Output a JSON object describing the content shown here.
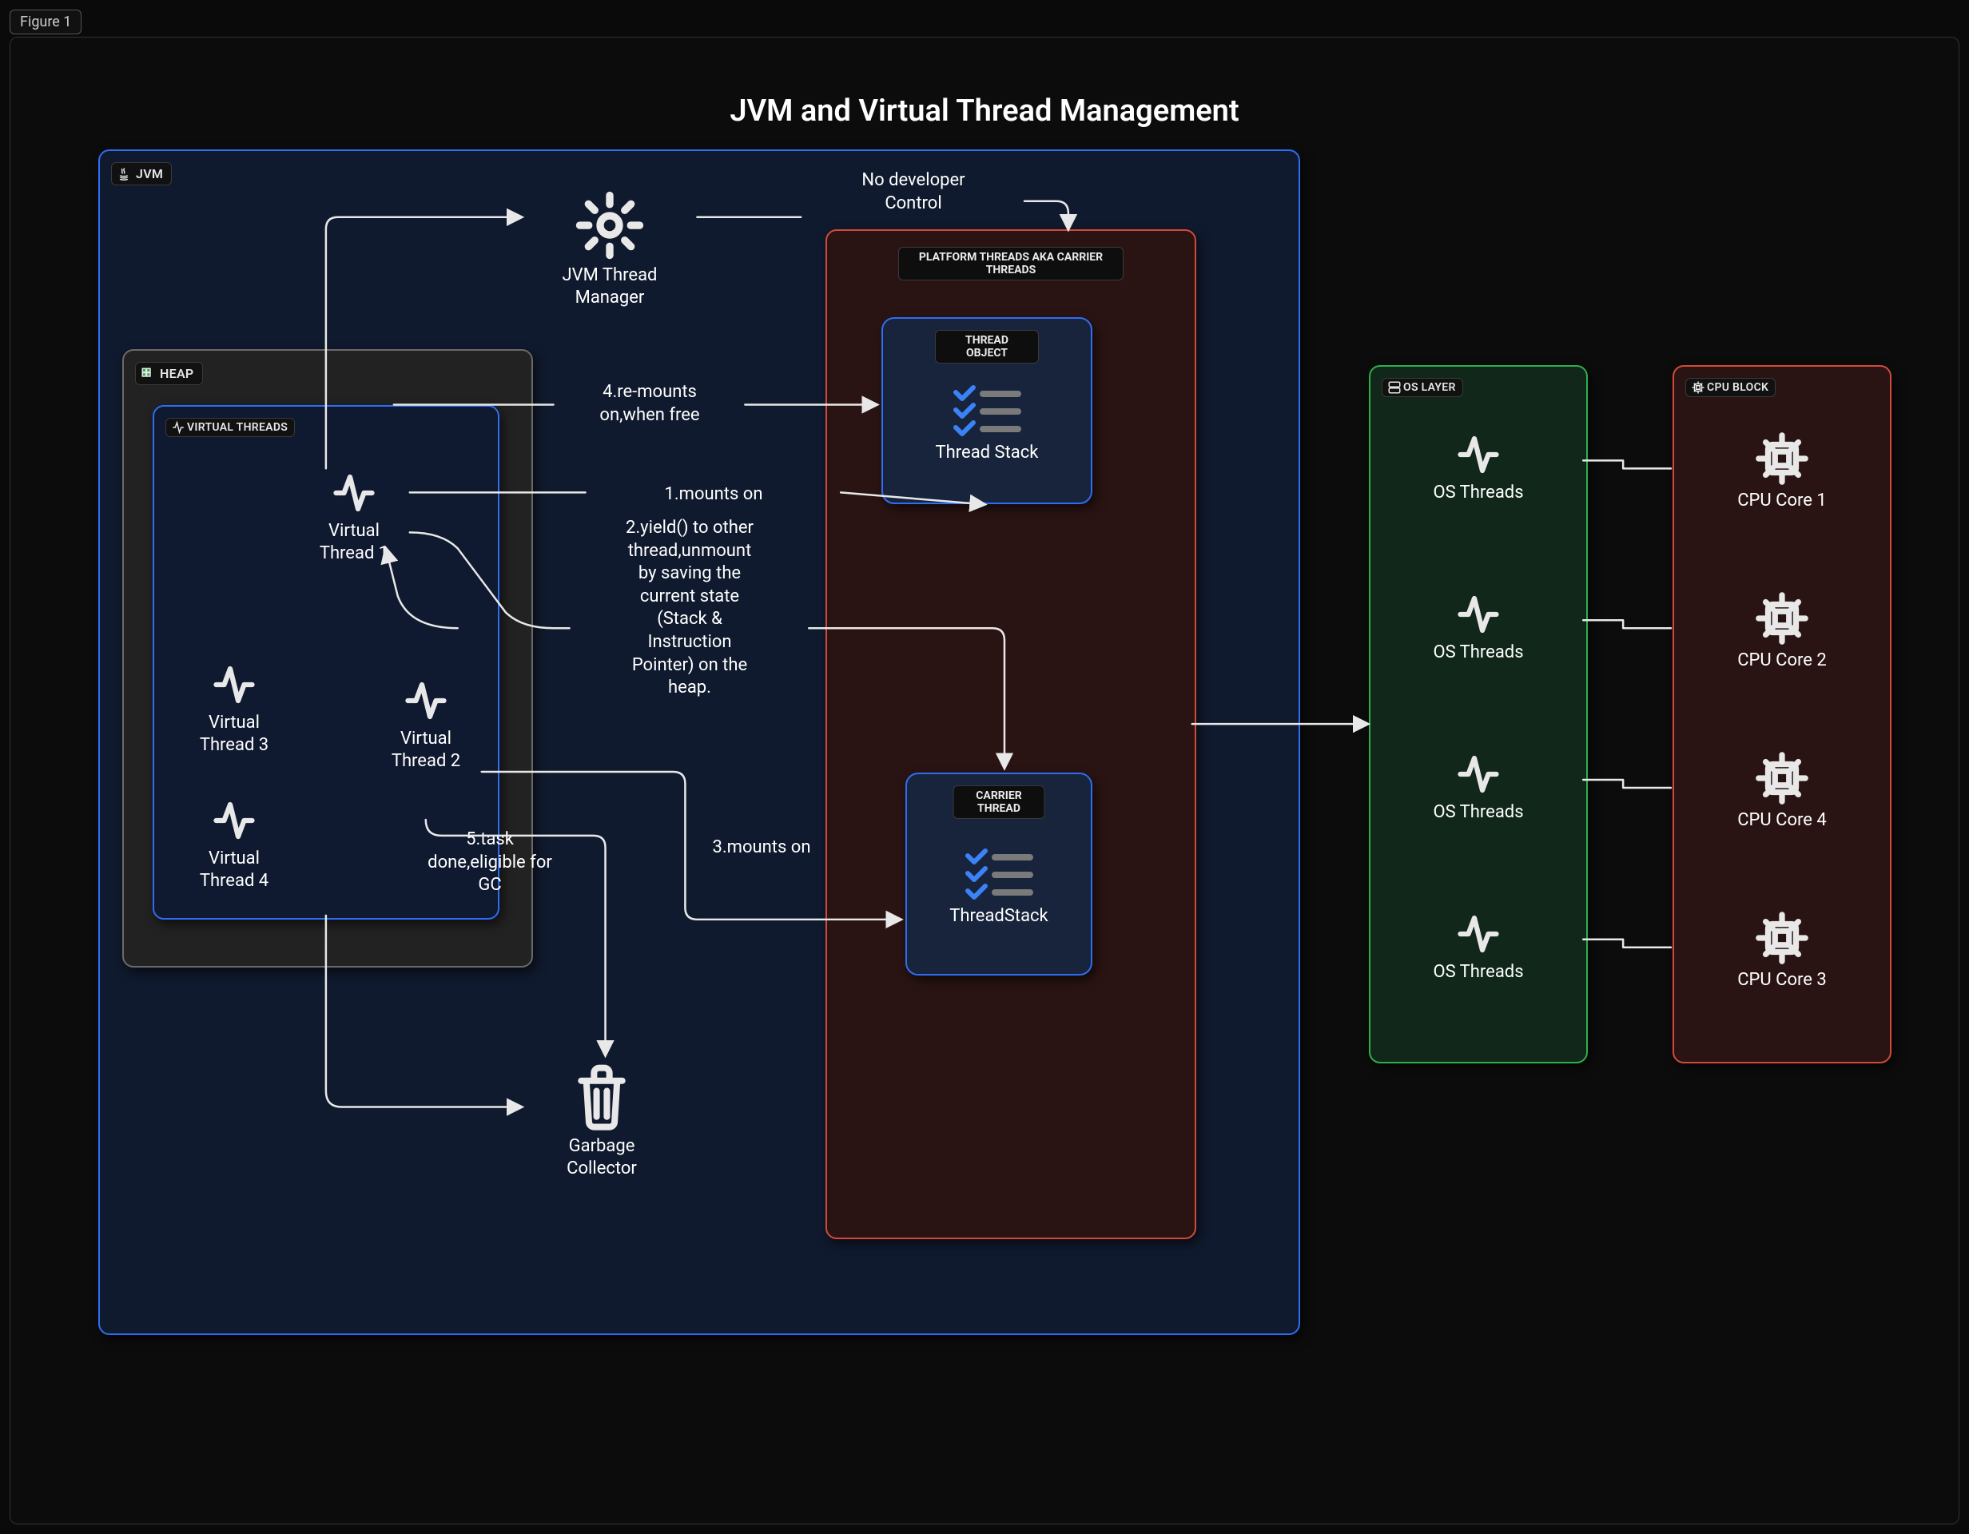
{
  "figure_tag": "Figure 1",
  "title": "JVM and Virtual Thread Management",
  "containers": {
    "jvm": "JVM",
    "heap": "HEAP",
    "virtual_threads": "VIRTUAL THREADS",
    "platform_threads": "PLATFORM THREADS AKA CARRIER THREADS",
    "thread_object": "THREAD OBJECT",
    "carrier_thread": "CARRIER THREAD",
    "os_layer": "OS LAYER",
    "cpu_block": "CPU BLOCK"
  },
  "nodes": {
    "jvm_thread_manager": "JVM Thread\nManager",
    "virtual_thread_1": "Virtual\nThread 1",
    "virtual_thread_2": "Virtual\nThread 2",
    "virtual_thread_3": "Virtual\nThread 3",
    "virtual_thread_4": "Virtual\nThread 4",
    "thread_stack_1": "Thread Stack",
    "thread_stack_2": "ThreadStack",
    "garbage_collector": "Garbage\nCollector",
    "os_threads": "OS Threads",
    "cpu_core_1": "CPU Core 1",
    "cpu_core_2": "CPU Core 2",
    "cpu_core_3": "CPU Core 3",
    "cpu_core_4": "CPU Core 4"
  },
  "edges": {
    "no_dev_control": "No developer\nControl",
    "remount": "4.re-mounts\non,when free",
    "mounts1": "1.mounts on",
    "yield": "2.yield() to other\nthread,unmount\nby saving the\ncurrent state\n(Stack &\nInstruction\nPointer) on the\nheap.",
    "mounts3": "3.mounts on",
    "task_done": "5.task\ndone,eligible for\nGC"
  },
  "colors": {
    "blue": "#2f6df2",
    "red": "#d24a3a",
    "green": "#2fae4e",
    "gray": "#6a6a6a"
  }
}
